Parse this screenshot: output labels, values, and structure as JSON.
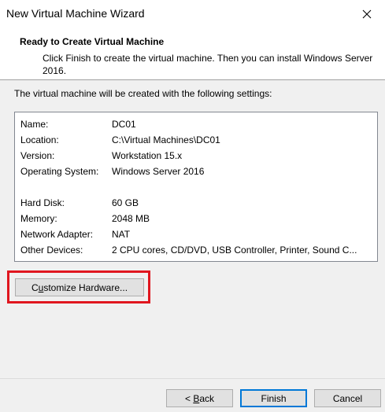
{
  "window": {
    "title": "New Virtual Machine Wizard",
    "close_icon": "close-icon"
  },
  "header": {
    "title": "Ready to Create Virtual Machine",
    "subtitle": "Click Finish to create the virtual machine. Then you can install Windows Server 2016."
  },
  "intro": "The virtual machine will be created with the following settings:",
  "settings": [
    {
      "key": "Name:",
      "value": "DC01"
    },
    {
      "key": "Location:",
      "value": "C:\\Virtual Machines\\DC01"
    },
    {
      "key": "Version:",
      "value": "Workstation 15.x"
    },
    {
      "key": "Operating System:",
      "value": "Windows Server 2016"
    },
    {
      "key": "Hard Disk:",
      "value": "60 GB"
    },
    {
      "key": "Memory:",
      "value": "2048 MB"
    },
    {
      "key": "Network Adapter:",
      "value": "NAT"
    },
    {
      "key": "Other Devices:",
      "value": "2 CPU cores, CD/DVD, USB Controller, Printer, Sound C..."
    }
  ],
  "buttons": {
    "customize_pre": "C",
    "customize_accel": "u",
    "customize_post": "stomize Hardware...",
    "back_pre": "< ",
    "back_accel": "B",
    "back_post": "ack",
    "finish": "Finish",
    "cancel": "Cancel"
  },
  "colors": {
    "highlight": "#e0161f",
    "default_button_border": "#0078d7"
  }
}
